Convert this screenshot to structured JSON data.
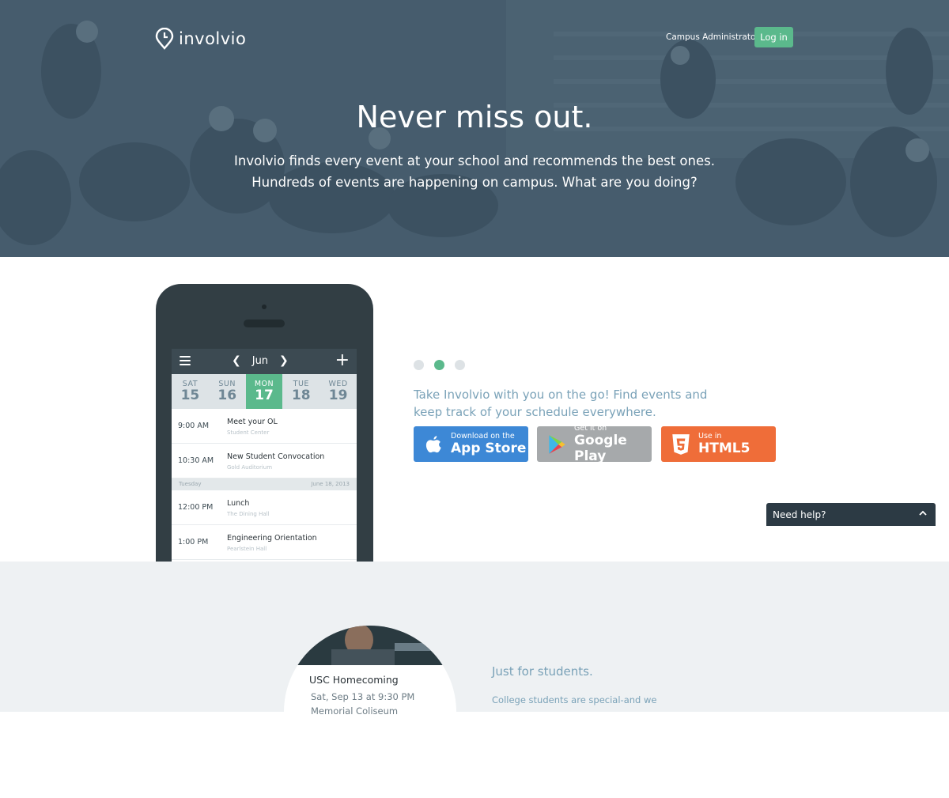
{
  "header": {
    "logo_text": "involvio",
    "admin_link": "Campus Administrator?",
    "login_button": "Log in"
  },
  "hero": {
    "title": "Never miss out.",
    "subtitle_line1": "Involvio finds every event at your school and recommends the best ones.",
    "subtitle_line2": "Hundreds of events are happening on campus. What are you doing?"
  },
  "phone_app": {
    "month": "Jun",
    "prev_icon": "chevron-left-icon",
    "next_icon": "chevron-right-icon",
    "days": [
      {
        "name": "SAT",
        "date": "15",
        "active": false
      },
      {
        "name": "SUN",
        "date": "16",
        "active": false
      },
      {
        "name": "MON",
        "date": "17",
        "active": true
      },
      {
        "name": "TUE",
        "date": "18",
        "active": false
      },
      {
        "name": "WED",
        "date": "19",
        "active": false
      }
    ],
    "events_day1": [
      {
        "time": "9:00 AM",
        "title": "Meet your OL",
        "location": "Student Center"
      },
      {
        "time": "10:30 AM",
        "title": "New Student Convocation",
        "location": "Gold Auditorium"
      }
    ],
    "separator": {
      "day": "Tuesday",
      "date": "June 18, 2013"
    },
    "events_day2": [
      {
        "time": "12:00 PM",
        "title": "Lunch",
        "location": "The Dining Hall"
      },
      {
        "time": "1:00 PM",
        "title": "Engineering Orientation",
        "location": "Pearlstein Hall"
      }
    ]
  },
  "carousel": {
    "dot_count": 3,
    "active_index": 1
  },
  "app_promo": {
    "text": "Take Involvio with you on the go! Find events and keep track of your schedule everywhere.",
    "buttons": [
      {
        "small": "Download on the",
        "big": "App Store",
        "color": "#3d88d6",
        "icon": "apple-icon"
      },
      {
        "small": "Get it on",
        "big": "Google Play",
        "color": "#a6a9ab",
        "icon": "google-play-icon"
      },
      {
        "small": "Use in",
        "big": "HTML5",
        "color": "#ef6d39",
        "icon": "html5-icon"
      }
    ]
  },
  "help_widget": {
    "label": "Need help?"
  },
  "feature": {
    "event_card": {
      "title": "USC Homecoming",
      "date": "Sat, Sep 13 at 9:30 PM",
      "location": "Memorial Coliseum"
    },
    "heading": "Just for students.",
    "body": "College students are special-and we"
  },
  "colors": {
    "accent_green": "#5bb98c",
    "hero_overlay": "#3a5262",
    "text_blue": "#7aa2b8"
  }
}
